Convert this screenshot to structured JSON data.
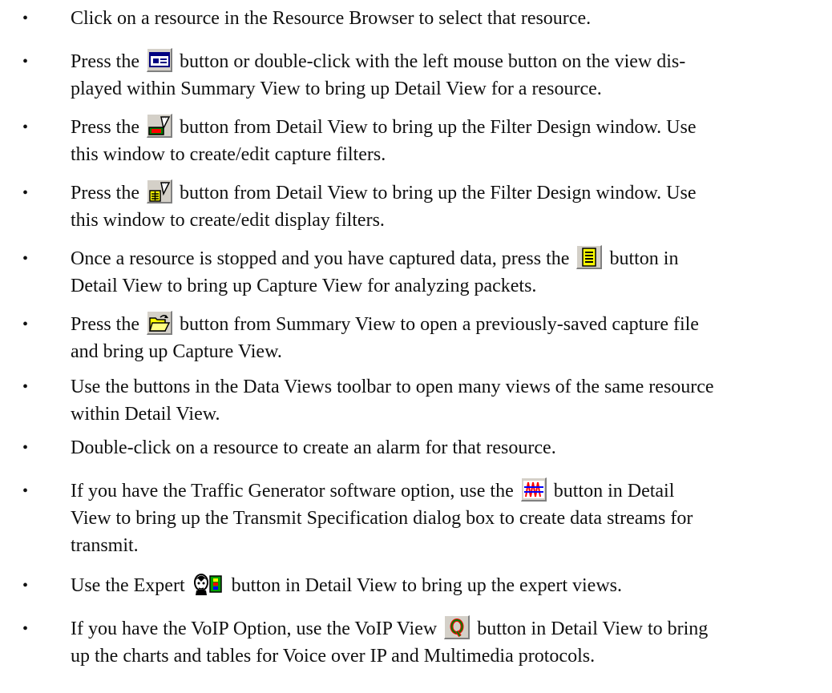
{
  "bullet_symbol": "•",
  "items": [
    {
      "pre": "Click on a resource in the Resource Browser to select that resource."
    },
    {
      "pre": "Press the",
      "icon": "detail-view-icon",
      "post": "button or double-click with the left mouse button on the view dis-",
      "line2": "played within Summary View to bring up Detail View for a resource."
    },
    {
      "pre": "Press the",
      "icon": "capture-filter-icon",
      "post": "button from Detail View to bring up the Filter Design window. Use",
      "line2": "this window to create/edit capture filters."
    },
    {
      "pre": "Press the",
      "icon": "display-filter-icon",
      "post": "button from Detail View to bring up the Filter Design window. Use",
      "line2": "this window to create/edit display filters."
    },
    {
      "pre": "Once a resource is stopped and you have captured data, press the",
      "icon": "capture-view-icon",
      "post": "button in",
      "line2": "Detail View to bring up Capture View for analyzing packets."
    },
    {
      "pre": "Press the",
      "icon": "open-folder-icon",
      "post": "button from Summary View to open a previously-saved capture file",
      "line2": "and bring up Capture View."
    },
    {
      "pre": "Use the buttons in the Data Views toolbar to open many views of the same resource",
      "line2": "within Detail View."
    },
    {
      "pre": "Double-click on a resource to create an alarm for that resource."
    },
    {
      "pre": "If you have the Traffic Generator software option, use the",
      "icon": "traffic-generator-icon",
      "post": "button in Detail",
      "line2": "View to bring up the Transmit Specification dialog box to create data streams for",
      "line3": "transmit."
    },
    {
      "pre": "Use the Expert",
      "icon": "expert-icon",
      "post": "button in Detail View to bring up the expert views."
    },
    {
      "pre": "If you have the VoIP Option, use the VoIP View",
      "icon": "voip-view-icon",
      "post": "button in Detail View to bring",
      "line2": "up the charts and tables for Voice over IP and Multimedia protocols."
    }
  ]
}
